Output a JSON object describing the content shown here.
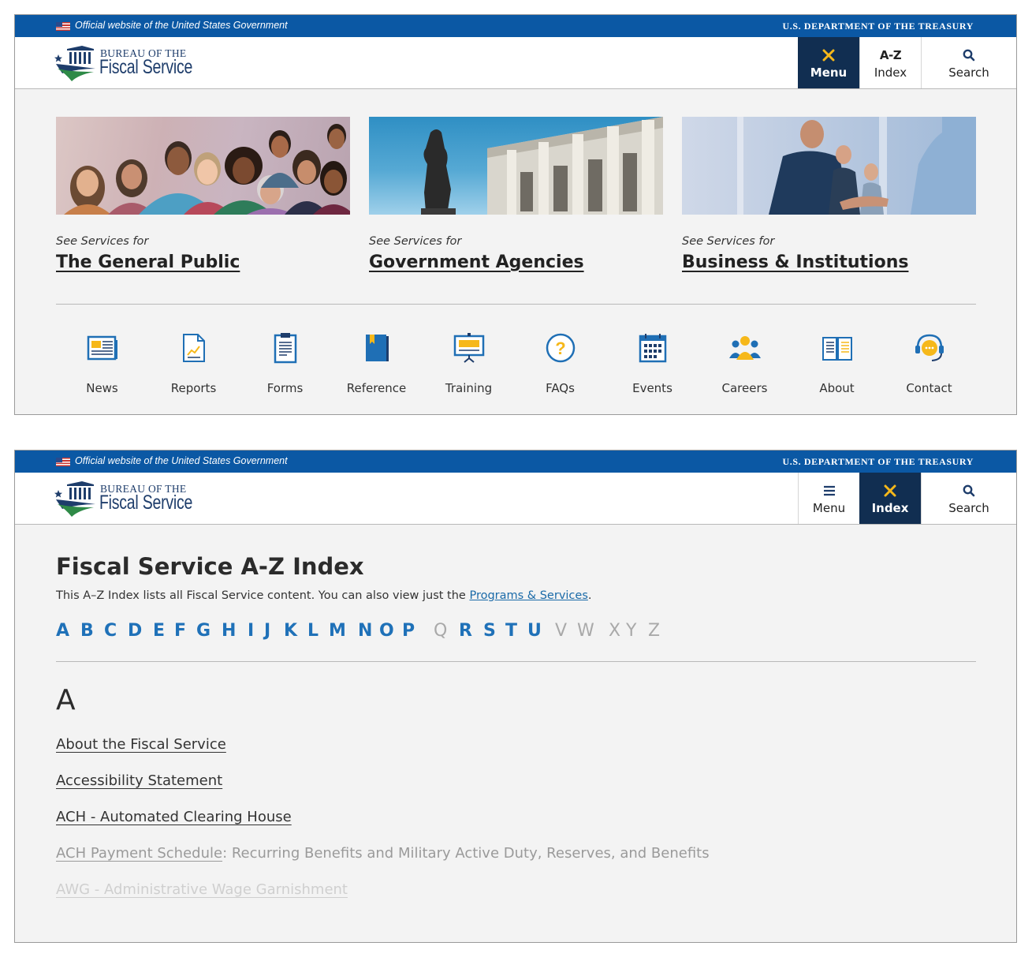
{
  "gov_banner": {
    "official": "Official website of the United States Government",
    "treasury": "U.S. DEPARTMENT OF THE TREASURY"
  },
  "logo": {
    "line1": "BUREAU OF THE",
    "line2": "Fiscal Service"
  },
  "colors": {
    "gov_blue": "#0b58a4",
    "navy": "#112e51",
    "accent_yellow": "#f6b81a",
    "link_blue": "#1f71b8"
  },
  "menu_view": {
    "nav": {
      "menu": "Menu",
      "index_abbr": "A-Z",
      "index": "Index",
      "search": "Search"
    },
    "audience_cards": [
      {
        "see": "See Services for",
        "title": "The General Public",
        "image": "diverse-people-photo"
      },
      {
        "see": "See Services for",
        "title": "Government Agencies",
        "image": "treasury-building-statue-photo"
      },
      {
        "see": "See Services for",
        "title": "Business & Institutions",
        "image": "business-handshake-photo"
      }
    ],
    "quick_links": [
      {
        "label": "News",
        "icon": "newspaper-icon"
      },
      {
        "label": "Reports",
        "icon": "report-chart-icon"
      },
      {
        "label": "Forms",
        "icon": "clipboard-icon"
      },
      {
        "label": "Reference",
        "icon": "book-icon"
      },
      {
        "label": "Training",
        "icon": "presentation-board-icon"
      },
      {
        "label": "FAQs",
        "icon": "question-circle-icon"
      },
      {
        "label": "Events",
        "icon": "calendar-icon"
      },
      {
        "label": "Careers",
        "icon": "people-group-icon"
      },
      {
        "label": "About",
        "icon": "open-book-icon"
      },
      {
        "label": "Contact",
        "icon": "headset-chat-icon"
      }
    ]
  },
  "index_view": {
    "nav": {
      "menu": "Menu",
      "index": "Index",
      "search": "Search"
    },
    "title": "Fiscal Service A-Z Index",
    "description": "This A–Z Index lists all Fiscal Service content. You can also view just the ",
    "description_link": "Programs & Services",
    "description_end": ".",
    "letters": [
      {
        "l": "A",
        "enabled": true
      },
      {
        "l": "B",
        "enabled": true
      },
      {
        "l": "C",
        "enabled": true
      },
      {
        "l": "D",
        "enabled": true
      },
      {
        "l": "E",
        "enabled": true
      },
      {
        "l": "F",
        "enabled": true
      },
      {
        "l": "G",
        "enabled": true
      },
      {
        "l": "H",
        "enabled": true
      },
      {
        "l": "I",
        "enabled": true
      },
      {
        "l": "J",
        "enabled": true
      },
      {
        "l": "K",
        "enabled": true
      },
      {
        "l": "L",
        "enabled": true
      },
      {
        "l": "M",
        "enabled": true
      },
      {
        "l": "N",
        "enabled": true
      },
      {
        "l": "O",
        "enabled": true
      },
      {
        "l": "P",
        "enabled": true
      },
      {
        "l": "Q",
        "enabled": false
      },
      {
        "l": "R",
        "enabled": true
      },
      {
        "l": "S",
        "enabled": true
      },
      {
        "l": "T",
        "enabled": true
      },
      {
        "l": "U",
        "enabled": true
      },
      {
        "l": "V",
        "enabled": false
      },
      {
        "l": "W",
        "enabled": false
      },
      {
        "l": "X",
        "enabled": false
      },
      {
        "l": "Y",
        "enabled": false
      },
      {
        "l": "Z",
        "enabled": false
      }
    ],
    "section_letter": "A",
    "entries": [
      {
        "link": "About the Fiscal Service",
        "suffix": ""
      },
      {
        "link": "Accessibility Statement",
        "suffix": ""
      },
      {
        "link": "ACH - Automated Clearing House",
        "suffix": ""
      },
      {
        "link": "ACH Payment Schedule",
        "suffix": ": Recurring Benefits and Military Active Duty, Reserves, and Benefits"
      },
      {
        "link": "AWG - Administrative Wage Garnishment",
        "suffix": ""
      }
    ]
  }
}
